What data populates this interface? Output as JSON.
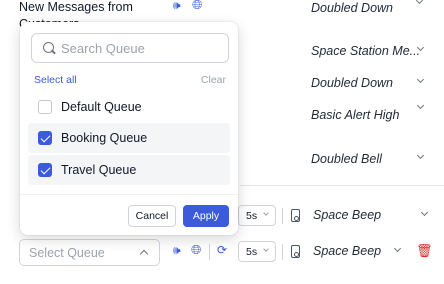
{
  "background_rows": [
    {
      "name": "New Messages from Customers",
      "sound": "Doubled Down"
    },
    {
      "sound": "Space Station Me..."
    },
    {
      "sound": "Doubled Down"
    },
    {
      "sound": "Basic Alert High"
    },
    {
      "sound": "Doubled Bell"
    },
    {
      "time": "5s",
      "sound": "Space Beep"
    }
  ],
  "bottom_row": {
    "placeholder": "Select Queue",
    "time": "5s",
    "sound": "Space Beep"
  },
  "dropdown": {
    "search_placeholder": "Search Queue",
    "select_all": "Select all",
    "clear": "Clear",
    "options": [
      {
        "label": "Default Queue",
        "checked": false
      },
      {
        "label": "Booking Queue",
        "checked": true
      },
      {
        "label": "Travel Queue",
        "checked": true
      }
    ],
    "cancel": "Cancel",
    "apply": "Apply"
  },
  "icons": {
    "volume": "volume-icon",
    "globe": "globe-icon",
    "refresh": "refresh-icon",
    "phone": "phone-icon",
    "trash": "trash-icon"
  },
  "colors": {
    "accent": "#3b5bdb",
    "danger": "#dc2626"
  }
}
